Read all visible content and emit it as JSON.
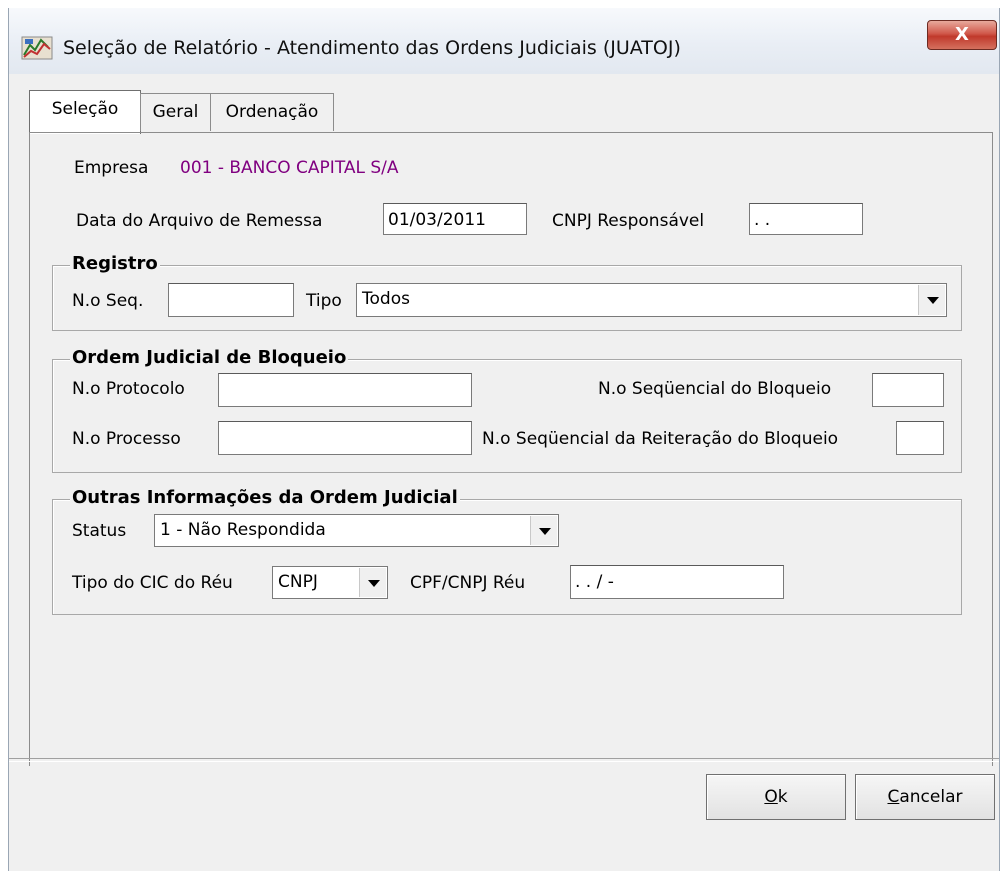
{
  "window": {
    "title": "Seleção de Relatório - Atendimento das Ordens Judiciais (JUATOJ)",
    "close_label": "X"
  },
  "tabs": [
    {
      "label": "Seleção",
      "active": true
    },
    {
      "label": "Geral",
      "active": false
    },
    {
      "label": "Ordenação",
      "active": false
    }
  ],
  "empresa": {
    "label": "Empresa",
    "value": "001 - BANCO CAPITAL S/A",
    "value_color": "#800080"
  },
  "data_arquivo": {
    "label": "Data do Arquivo de Remessa",
    "value": "01/03/2011"
  },
  "cnpj_responsavel": {
    "label": "CNPJ Responsável",
    "value": ". ."
  },
  "registro": {
    "title": "Registro",
    "seq_label": "N.o Seq.",
    "seq_value": "",
    "tipo_label": "Tipo",
    "tipo_value": "Todos"
  },
  "ordem": {
    "title": "Ordem Judicial de Bloqueio",
    "protocolo_label": "N.o Protocolo",
    "protocolo_value": "",
    "seq_bloqueio_label": "N.o Seqüencial do Bloqueio",
    "seq_bloqueio_value": "",
    "processo_label": "N.o Processo",
    "processo_value": "",
    "seq_reiteracao_label": "N.o Seqüencial da Reiteração do Bloqueio",
    "seq_reiteracao_value": ""
  },
  "outras": {
    "title": "Outras Informações da Ordem Judicial",
    "status_label": "Status",
    "status_value": "1 - Não Respondida",
    "tipo_cic_label": "Tipo do CIC do Réu",
    "tipo_cic_value": "CNPJ",
    "cpf_label": "CPF/CNPJ Réu",
    "cpf_value": ". .  /  -"
  },
  "buttons": {
    "ok_mnemonic": "O",
    "ok_rest": "k",
    "cancel_mnemonic": "C",
    "cancel_rest": "ancelar"
  },
  "icons": {
    "app": "report-app-icon",
    "close": "close-icon",
    "dropdown": "chevron-down-icon"
  }
}
